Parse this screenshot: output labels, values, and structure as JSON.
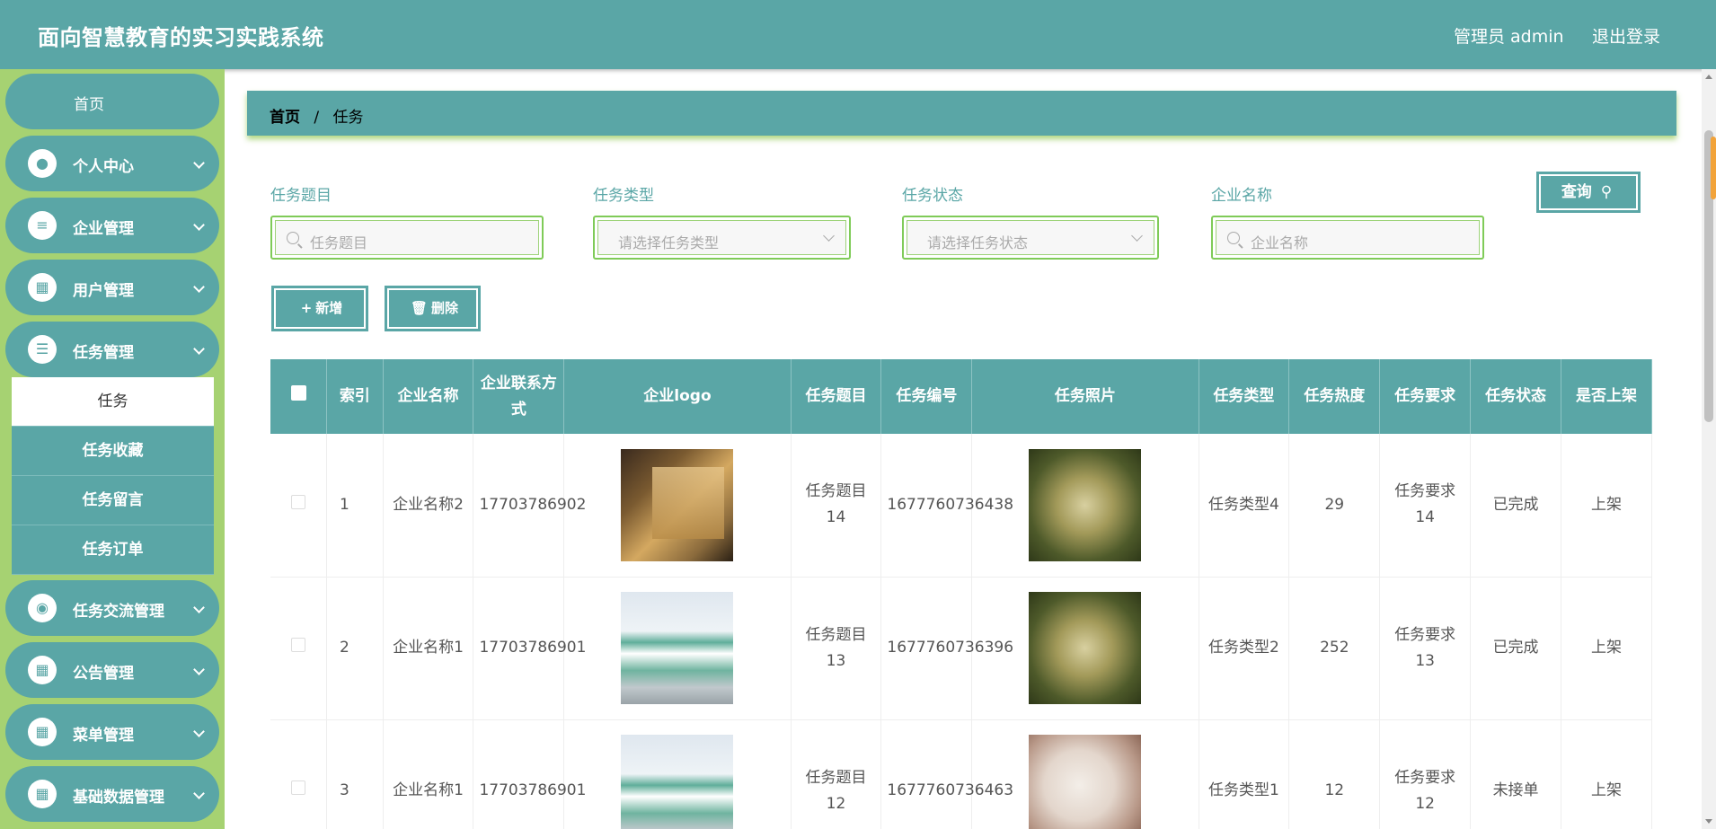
{
  "header": {
    "title": "面向智慧教育的实习实践系统",
    "user": "管理员 admin",
    "logout": "退出登录"
  },
  "sidebar": {
    "items": [
      {
        "label": "首页",
        "icon": ""
      },
      {
        "label": "个人中心",
        "icon": "person-icon"
      },
      {
        "label": "企业管理",
        "icon": "sliders-icon"
      },
      {
        "label": "用户管理",
        "icon": "grid-icon"
      },
      {
        "label": "任务管理",
        "icon": "list-icon"
      },
      {
        "label": "任务交流管理",
        "icon": "bulb-icon"
      },
      {
        "label": "公告管理",
        "icon": "grid-icon"
      },
      {
        "label": "菜单管理",
        "icon": "grid-icon"
      },
      {
        "label": "基础数据管理",
        "icon": "grid-icon"
      }
    ],
    "submenu": [
      "任务",
      "任务收藏",
      "任务留言",
      "任务订单"
    ]
  },
  "breadcrumb": {
    "home": "首页",
    "sep": "/",
    "current": "任务"
  },
  "search": {
    "title_label": "任务题目",
    "title_placeholder": "任务题目",
    "type_label": "任务类型",
    "type_placeholder": "请选择任务类型",
    "status_label": "任务状态",
    "status_placeholder": "请选择任务状态",
    "company_label": "企业名称",
    "company_placeholder": "企业名称",
    "query": "查询"
  },
  "actions": {
    "add": "新增",
    "delete": "删除"
  },
  "table": {
    "columns": [
      "",
      "索引",
      "企业名称",
      "企业联系方式",
      "企业logo",
      "任务题目",
      "任务编号",
      "任务照片",
      "任务类型",
      "任务热度",
      "任务要求",
      "任务状态",
      "是否上架"
    ],
    "rows": [
      {
        "index": "1",
        "company": "企业名称2",
        "phone": "17703786902",
        "title": "任务题目14",
        "code": "1677760736438",
        "type": "任务类型4",
        "heat": "29",
        "req": "任务要求14",
        "status": "已完成",
        "shelf": "上架"
      },
      {
        "index": "2",
        "company": "企业名称1",
        "phone": "17703786901",
        "title": "任务题目13",
        "code": "1677760736396",
        "type": "任务类型2",
        "heat": "252",
        "req": "任务要求13",
        "status": "已完成",
        "shelf": "上架"
      },
      {
        "index": "3",
        "company": "企业名称1",
        "phone": "17703786901",
        "title": "任务题目12",
        "code": "1677760736463",
        "type": "任务类型1",
        "heat": "12",
        "req": "任务要求12",
        "status": "未接单",
        "shelf": "上架"
      }
    ]
  },
  "colors": {
    "primary": "#5aa6a6",
    "sidebar_bg": "#a6d272",
    "field_border": "#7fcb58"
  }
}
